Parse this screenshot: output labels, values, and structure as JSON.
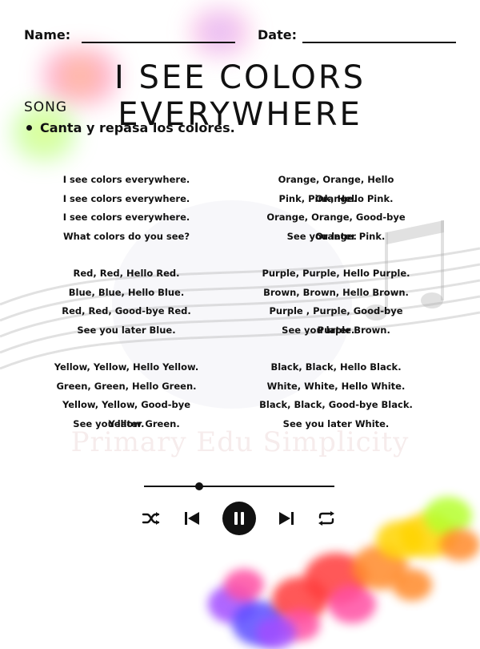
{
  "header": {
    "name_label": "Name:",
    "date_label": "Date:"
  },
  "title": "I SEE COLORS EVERYWHERE",
  "subtitle": "SONG",
  "instruction": "Canta y repasa los colores.",
  "watermark": "Primary Edu Simplicity",
  "lyrics_left": [
    [
      "I see colors everywhere.",
      "I see colors everywhere.",
      "I see colors everywhere.",
      "What colors do you see?"
    ],
    [
      "Red, Red, Hello Red.",
      "Blue, Blue, Hello Blue.",
      "Red, Red, Good-bye Red.",
      "See you later Blue."
    ],
    [
      "Yellow, Yellow, Hello Yellow.",
      "Green, Green, Hello Green.",
      "Yellow, Yellow, Good-bye Yellow.",
      "See you later Green."
    ]
  ],
  "lyrics_right": [
    [
      "Orange, Orange, Hello Orange.",
      "Pink, Pink, Hello Pink.",
      "Orange, Orange, Good-bye Orange.",
      "See you later Pink."
    ],
    [
      "Purple, Purple, Hello Purple.",
      "Brown, Brown, Hello Brown.",
      "Purple , Purple, Good-bye Purple.",
      "See you later Brown."
    ],
    [
      "Black, Black, Hello Black.",
      "White, White, Hello White.",
      "Black, Black, Good-bye Black.",
      "See you later White."
    ]
  ],
  "player": {
    "progress": 0.29,
    "controls": [
      "shuffle-icon",
      "previous-icon",
      "pause-icon",
      "next-icon",
      "repeat-icon"
    ]
  },
  "colors": {
    "splash": [
      "#ff3b3b",
      "#ff8a2a",
      "#ffd400",
      "#b6ff2e",
      "#a24dff",
      "#5b4dff",
      "#ff4fa3"
    ]
  }
}
